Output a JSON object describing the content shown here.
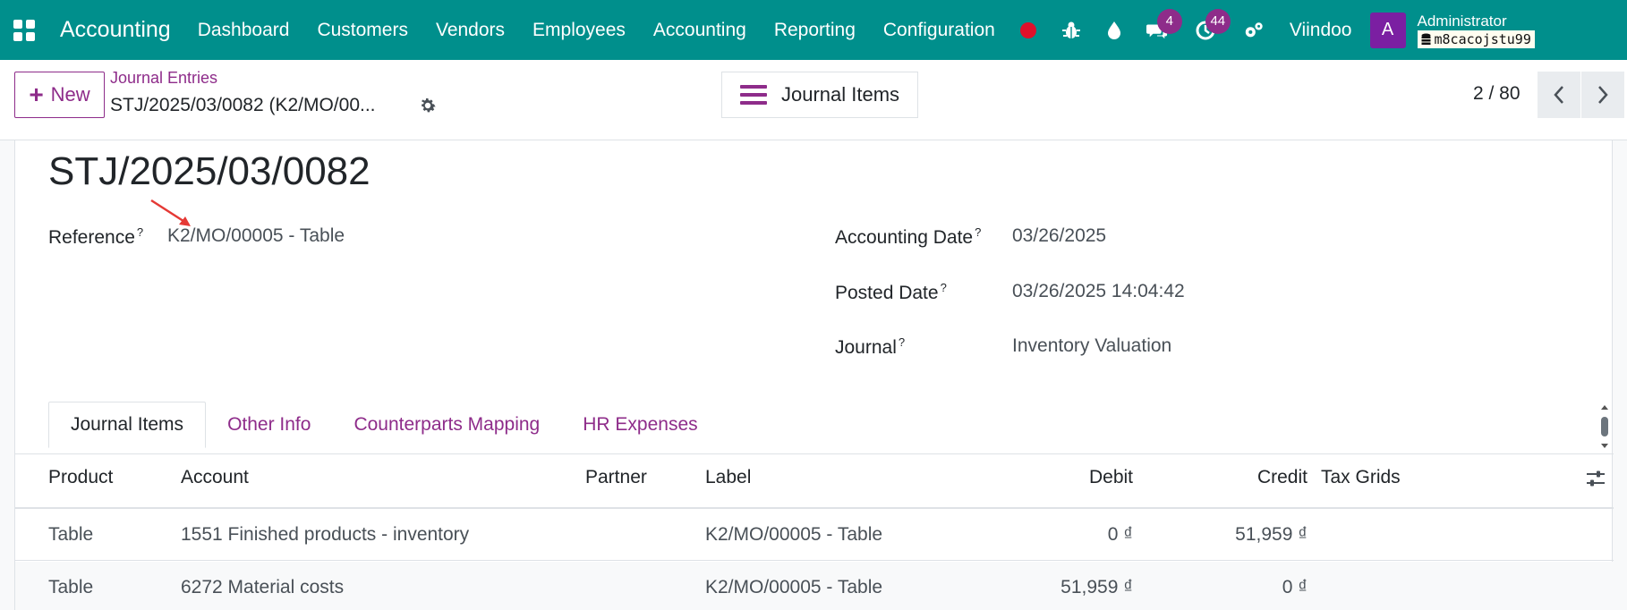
{
  "navbar": {
    "app_name": "Accounting",
    "menu": [
      "Dashboard",
      "Customers",
      "Vendors",
      "Employees",
      "Accounting",
      "Reporting",
      "Configuration"
    ],
    "messages_count": "4",
    "activities_count": "44",
    "company": "Viindoo",
    "avatar_letter": "A",
    "user": "Administrator",
    "database": "m8cacojstu99",
    "colors": {
      "bar": "#008f8c",
      "badge": "#8e2c8a",
      "avatar": "#7b1fa2",
      "record_dot": "#e0102b"
    }
  },
  "control": {
    "new_label": "New",
    "breadcrumb": "Journal Entries",
    "record_name": "STJ/2025/03/0082 (K2/MO/00...",
    "view_label": "Journal Items",
    "pager": "2 / 80"
  },
  "form": {
    "title": "STJ/2025/03/0082",
    "reference_label": "Reference",
    "reference_value": "K2/MO/00005 - Table",
    "accounting_date_label": "Accounting Date",
    "accounting_date_value": "03/26/2025",
    "posted_date_label": "Posted Date",
    "posted_date_value": "03/26/2025 14:04:42",
    "journal_label": "Journal",
    "journal_value": "Inventory Valuation",
    "help_mark": "?"
  },
  "tabs": [
    "Journal Items",
    "Other Info",
    "Counterparts Mapping",
    "HR Expenses"
  ],
  "table": {
    "headers": {
      "product": "Product",
      "account": "Account",
      "partner": "Partner",
      "label": "Label",
      "debit": "Debit",
      "credit": "Credit",
      "tax_grids": "Tax Grids"
    },
    "rows": [
      {
        "product": "Table",
        "account": "1551 Finished products - inventory",
        "partner": "",
        "label": "K2/MO/00005 - Table",
        "debit": "0 ₫",
        "credit": "51,959 ₫"
      },
      {
        "product": "Table",
        "account": "6272 Material costs",
        "partner": "",
        "label": "K2/MO/00005 - Table",
        "debit": "51,959 ₫",
        "credit": "0 ₫"
      }
    ]
  }
}
